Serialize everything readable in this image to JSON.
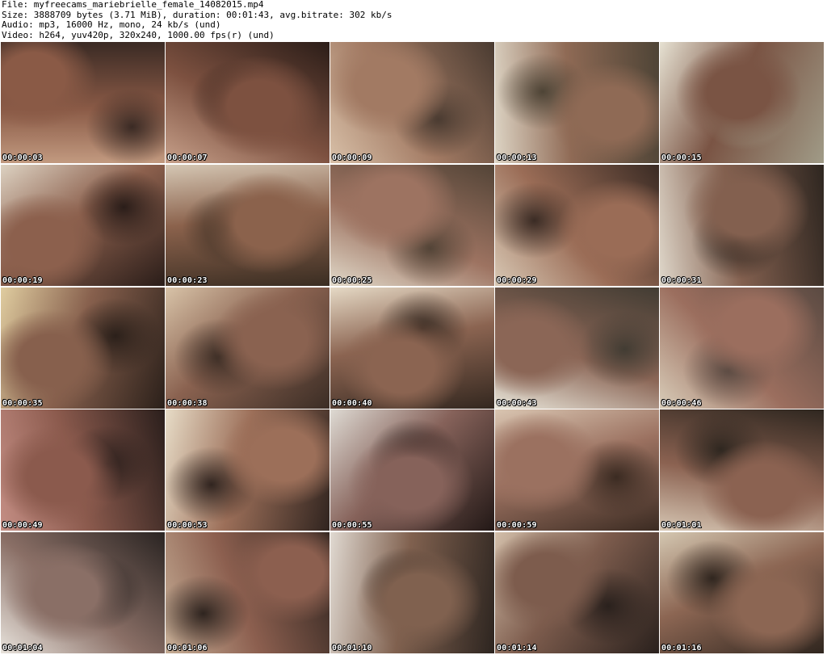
{
  "header": {
    "file_line": "File: myfreecams_mariebrielle_female_14082015.mp4",
    "size_line": "Size: 3888709 bytes (3.71 MiB), duration: 00:01:43, avg.bitrate: 302 kb/s",
    "audio_line": "Audio: mp3, 16000 Hz, mono, 24 kb/s (und)",
    "video_line": "Video: h264, yuv420p, 320x240, 1000.00 fps(r) (und)"
  },
  "frames": [
    {
      "timestamp": "00:00:03",
      "palette": [
        "#3a2a24",
        "#8a5a46",
        "#c29a80"
      ]
    },
    {
      "timestamp": "00:00:07",
      "palette": [
        "#2b1d18",
        "#7d5140",
        "#c7a08a"
      ]
    },
    {
      "timestamp": "00:00:09",
      "palette": [
        "#4a3b31",
        "#a27a63",
        "#d8c0a8"
      ]
    },
    {
      "timestamp": "00:00:13",
      "palette": [
        "#4e4436",
        "#8f6a55",
        "#ddd4c4"
      ]
    },
    {
      "timestamp": "00:00:15",
      "palette": [
        "#a09b87",
        "#7a5444",
        "#e6e1d2"
      ]
    },
    {
      "timestamp": "00:00:19",
      "palette": [
        "#2a1d19",
        "#8c604d",
        "#ddd2c2"
      ]
    },
    {
      "timestamp": "00:00:23",
      "palette": [
        "#3a2d22",
        "#8b624c",
        "#d5c7b4"
      ]
    },
    {
      "timestamp": "00:00:25",
      "palette": [
        "#534437",
        "#9d7361",
        "#e1d9c9"
      ]
    },
    {
      "timestamp": "00:00:29",
      "palette": [
        "#3a2b24",
        "#9a6c56",
        "#d8c8b4"
      ]
    },
    {
      "timestamp": "00:00:31",
      "palette": [
        "#2e2620",
        "#83604f",
        "#dfd7ca"
      ]
    },
    {
      "timestamp": "00:00:35",
      "palette": [
        "#2b201a",
        "#87604d",
        "#e0cda0"
      ]
    },
    {
      "timestamp": "00:00:38",
      "palette": [
        "#3b2d25",
        "#8a6250",
        "#d8c3a8"
      ]
    },
    {
      "timestamp": "00:00:40",
      "palette": [
        "#33271f",
        "#8b6451",
        "#e5d9c5"
      ]
    },
    {
      "timestamp": "00:00:43",
      "palette": [
        "#423c33",
        "#8b6656",
        "#e9e6da"
      ]
    },
    {
      "timestamp": "00:00:46",
      "palette": [
        "#5a4a42",
        "#9b6e5e",
        "#d9cdb9"
      ]
    },
    {
      "timestamp": "00:00:49",
      "palette": [
        "#2b1f1c",
        "#8b5a4d",
        "#c48e84"
      ]
    },
    {
      "timestamp": "00:00:53",
      "palette": [
        "#30241f",
        "#9c6f59",
        "#e7dcc7"
      ]
    },
    {
      "timestamp": "00:00:55",
      "palette": [
        "#221816",
        "#86625a",
        "#dedad3"
      ]
    },
    {
      "timestamp": "00:00:59",
      "palette": [
        "#3b2b22",
        "#9b7160",
        "#d9c5b1"
      ]
    },
    {
      "timestamp": "00:01:01",
      "palette": [
        "#2f2720",
        "#8b6251",
        "#d6c6b3"
      ]
    },
    {
      "timestamp": "00:01:04",
      "palette": [
        "#2a2422",
        "#8a6f66",
        "#e8e3dc"
      ]
    },
    {
      "timestamp": "00:01:06",
      "palette": [
        "#2e241f",
        "#8c5f4f",
        "#c6ae96"
      ]
    },
    {
      "timestamp": "00:01:10",
      "palette": [
        "#2d2520",
        "#80614f",
        "#e0d9d1"
      ]
    },
    {
      "timestamp": "00:01:14",
      "palette": [
        "#2a211d",
        "#7d5c4d",
        "#d3bfaa"
      ]
    },
    {
      "timestamp": "00:01:16",
      "palette": [
        "#30261f",
        "#8c6653",
        "#d4c7b1"
      ]
    }
  ]
}
